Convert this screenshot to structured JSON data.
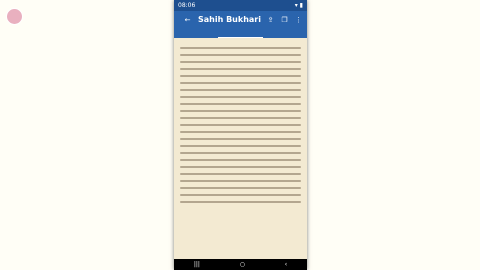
{
  "status": {
    "time": "08:06"
  },
  "app": {
    "title": "Sahih Bukhari"
  },
  "tabs": [
    {
      "label": ""
    },
    {
      "label": ""
    },
    {
      "label": ""
    }
  ],
  "colors": {
    "appbar": "#2a64ad",
    "statusbar": "#1e4f8f",
    "page": "#f3ead2"
  },
  "icons": {
    "back": "back-icon",
    "share": "share-icon",
    "copy": "copy-icon",
    "menu": "more-icon"
  }
}
